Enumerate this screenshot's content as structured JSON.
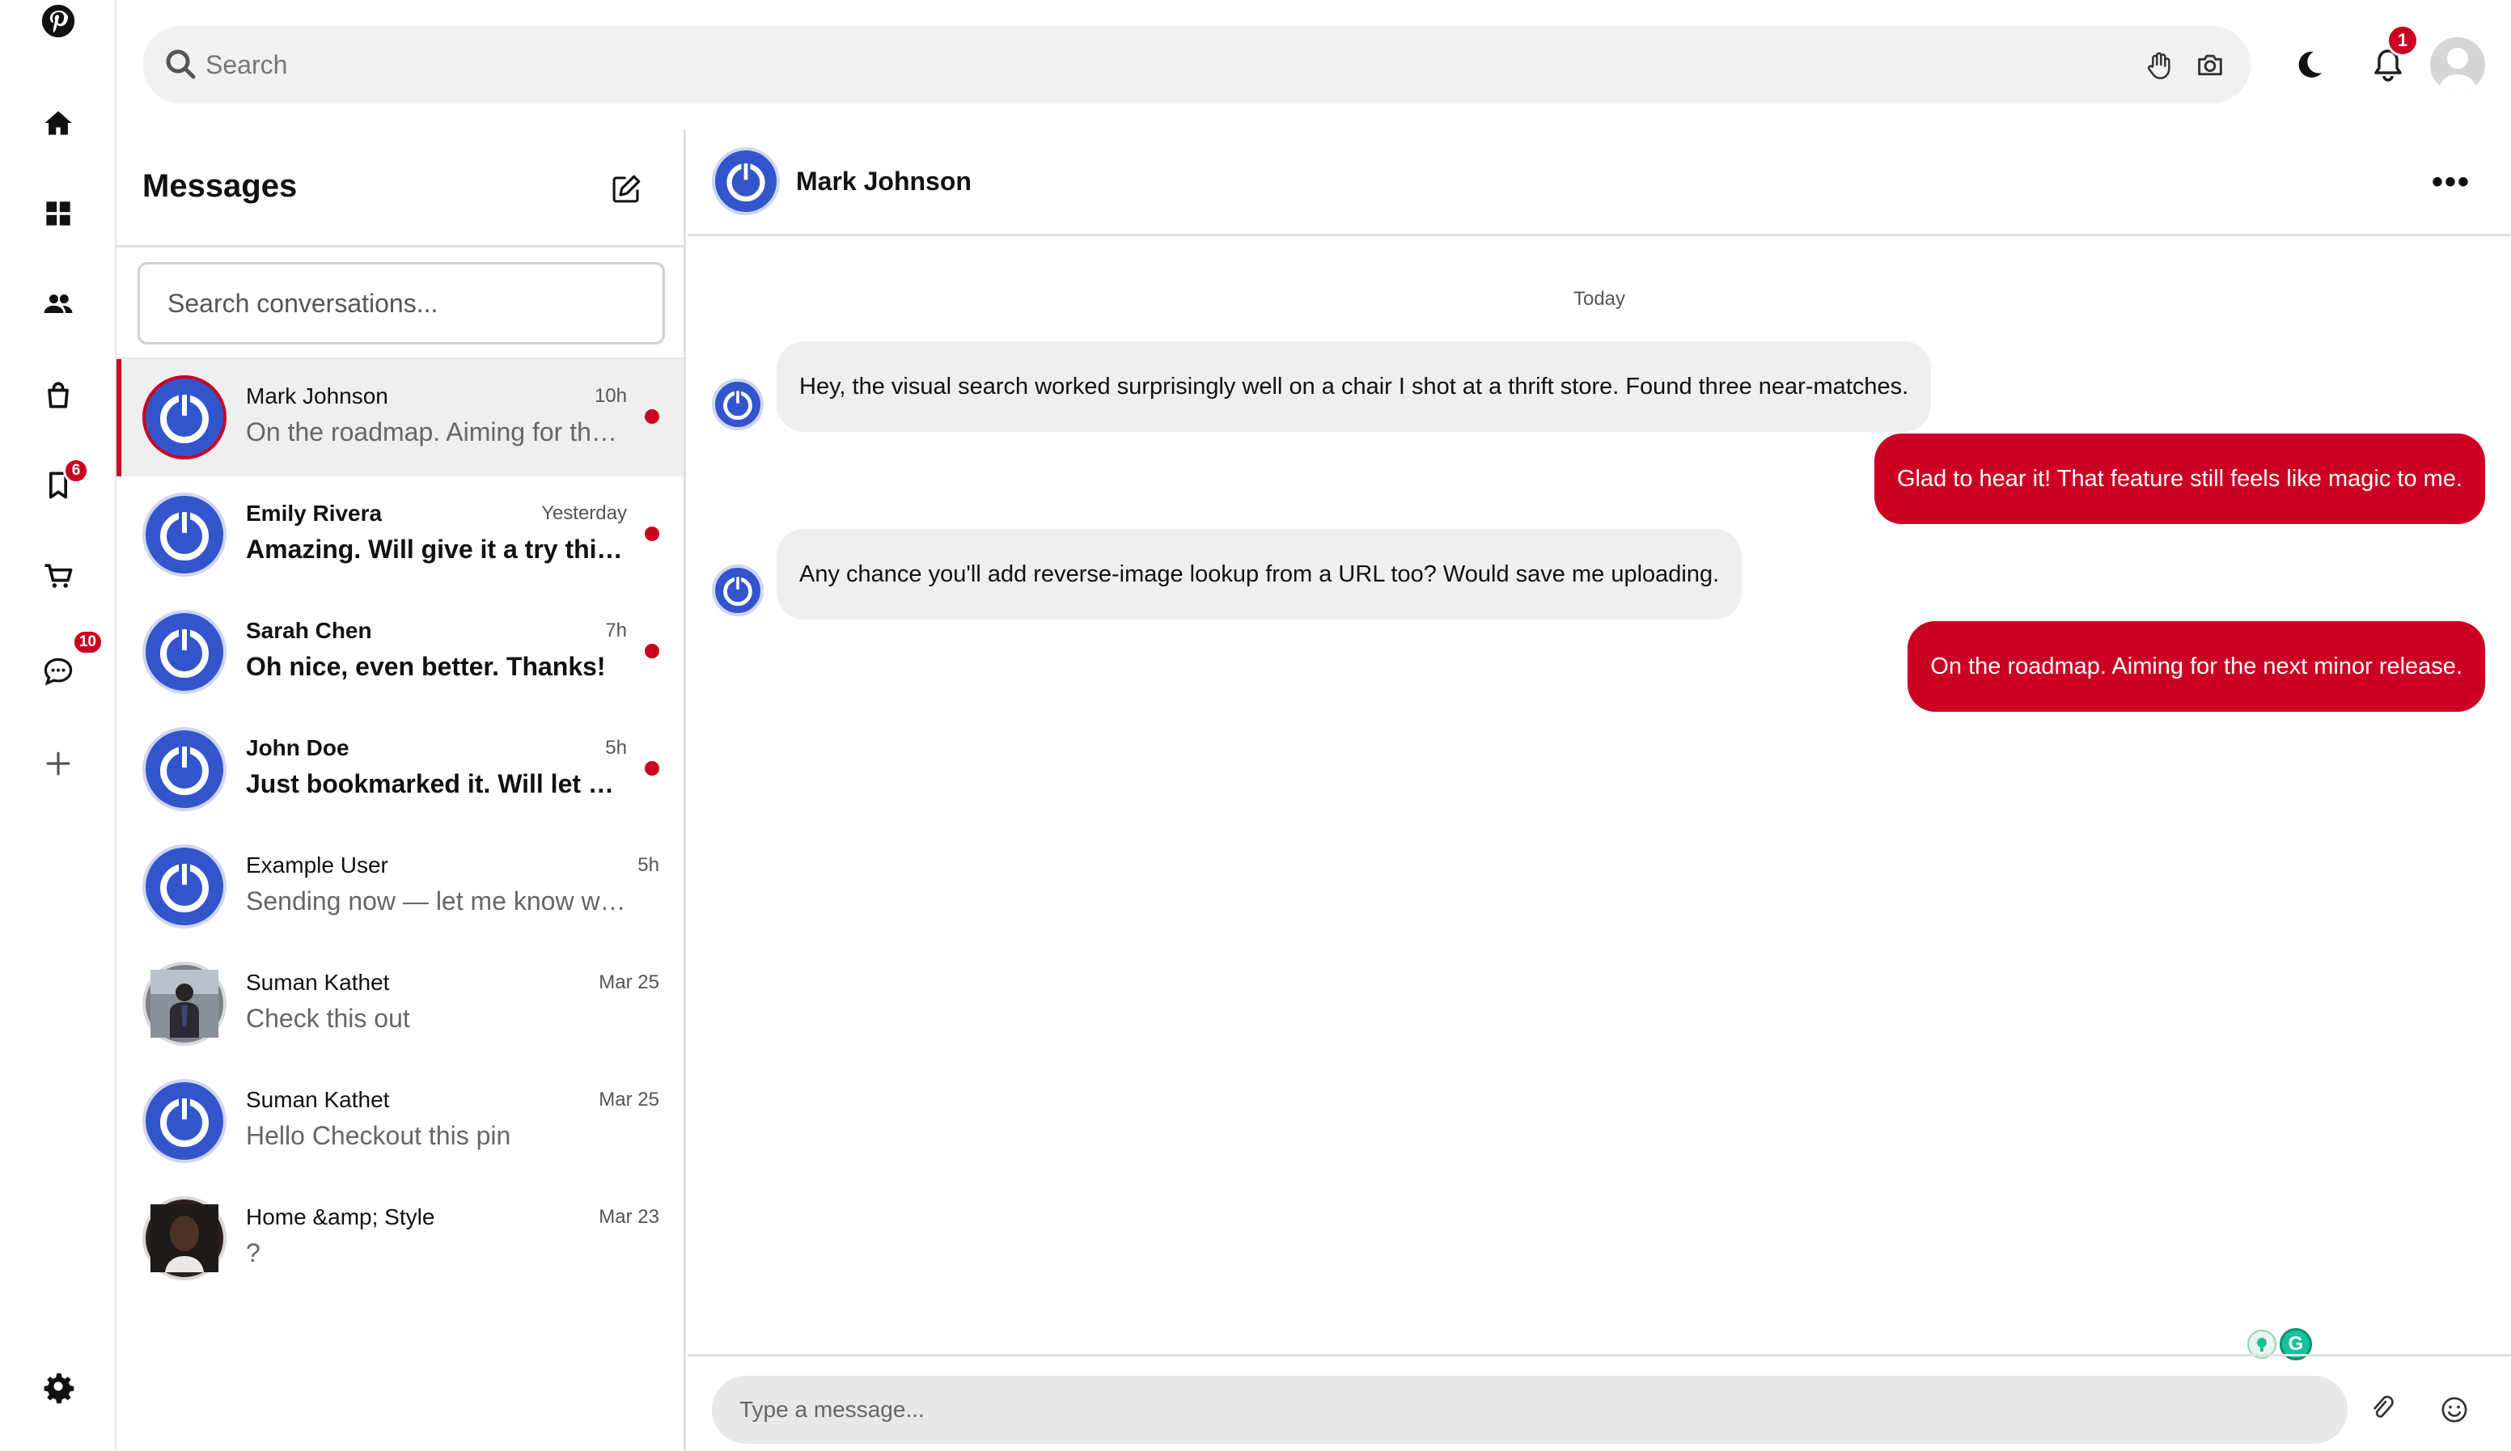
{
  "search": {
    "placeholder": "Search"
  },
  "notifications": {
    "count": "1"
  },
  "sidebar": {
    "items": [
      {
        "name": "home"
      },
      {
        "name": "boards"
      },
      {
        "name": "people"
      },
      {
        "name": "shop"
      },
      {
        "name": "saved",
        "badge": "6"
      },
      {
        "name": "cart"
      },
      {
        "name": "messages",
        "badge": "10"
      },
      {
        "name": "create"
      }
    ]
  },
  "messages_panel": {
    "title": "Messages",
    "search_placeholder": "Search conversations...",
    "conversations": [
      {
        "name": "Mark Johnson",
        "time": "10h",
        "preview": "On the roadmap. Aiming for the next minor release.",
        "unread": false,
        "active": true,
        "avatar": "power"
      },
      {
        "name": "Emily Rivera",
        "time": "Yesterday",
        "preview": "Amazing. Will give it a try this weekend.",
        "unread": true,
        "active": false,
        "avatar": "power"
      },
      {
        "name": "Sarah Chen",
        "time": "7h",
        "preview": "Oh nice, even better. Thanks!",
        "unread": true,
        "active": false,
        "avatar": "power"
      },
      {
        "name": "John Doe",
        "time": "5h",
        "preview": "Just bookmarked it. Will let you know.",
        "unread": true,
        "active": false,
        "avatar": "power"
      },
      {
        "name": "Example User",
        "time": "5h",
        "preview": "Sending now — let me know what you think",
        "unread": false,
        "active": false,
        "avatar": "power"
      },
      {
        "name": "Suman Kathet",
        "time": "Mar 25",
        "preview": "Check this out",
        "unread": false,
        "active": false,
        "avatar": "photo"
      },
      {
        "name": "Suman Kathet",
        "time": "Mar 25",
        "preview": "Hello Checkout this pin",
        "unread": false,
        "active": false,
        "avatar": "power"
      },
      {
        "name": "Home &amp; Style",
        "time": "Mar 23",
        "preview": "?",
        "unread": false,
        "active": false,
        "avatar": "photo2"
      }
    ]
  },
  "chat": {
    "name": "Mark Johnson",
    "day_label": "Today",
    "messages": [
      {
        "from": "them",
        "text": "Hey, the visual search worked surprisingly well on a chair I shot at a thrift store. Found three near-matches."
      },
      {
        "from": "me",
        "text": "Glad to hear it! That feature still feels like magic to me."
      },
      {
        "from": "them",
        "text": "Any chance you'll add reverse-image lookup from a URL too? Would save me uploading."
      },
      {
        "from": "me",
        "text": "On the roadmap. Aiming for the next minor release."
      }
    ],
    "composer_placeholder": "Type a message..."
  },
  "colors": {
    "accent": "#cc0022",
    "avatar_blue": "#3355cc",
    "bubble_in": "#efefef"
  },
  "icons": [
    "pinterest-logo",
    "home",
    "grid",
    "people",
    "bag",
    "bookmark",
    "cart",
    "chat-bubble",
    "plus",
    "gear",
    "search",
    "hand",
    "camera",
    "moon",
    "bell",
    "edit",
    "ellipsis",
    "paperclip",
    "smiley"
  ]
}
